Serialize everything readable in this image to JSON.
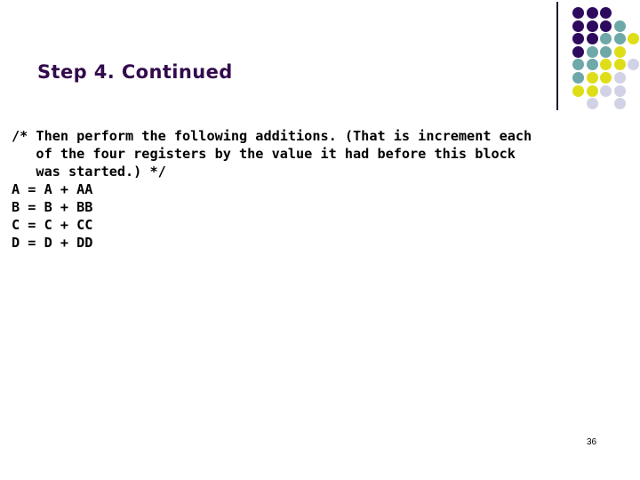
{
  "slide": {
    "title": "Step 4. Continued",
    "title_color": "#330a4d",
    "background_color": "#ffffff",
    "page_number": "36"
  },
  "code": {
    "lines": [
      "/* Then perform the following additions. (That is increment each",
      "   of the four registers by the value it had before this block",
      "   was started.) */",
      "A = A + AA",
      "B = B + BB",
      "C = C + CC",
      "D = D + DD"
    ],
    "text_color": "#000000"
  },
  "decoration": {
    "divider_color": "#1c1c2e",
    "palette": {
      "purple": "#2d0a5e",
      "teal": "#6ea8a8",
      "yellow": "#dede18",
      "lavender": "#d2d2e6",
      "empty": "transparent"
    },
    "grid_rows": [
      [
        "purple",
        "purple",
        "purple",
        "empty",
        "empty"
      ],
      [
        "purple",
        "purple",
        "purple",
        "teal",
        "empty"
      ],
      [
        "purple",
        "purple",
        "teal",
        "teal",
        "yellow"
      ],
      [
        "purple",
        "teal",
        "teal",
        "yellow",
        "empty"
      ],
      [
        "teal",
        "teal",
        "yellow",
        "yellow",
        "lavender"
      ],
      [
        "teal",
        "yellow",
        "yellow",
        "lavender",
        "empty"
      ],
      [
        "yellow",
        "yellow",
        "lavender",
        "lavender",
        "empty"
      ],
      [
        "empty",
        "lavender",
        "empty",
        "lavender",
        "empty"
      ]
    ]
  }
}
